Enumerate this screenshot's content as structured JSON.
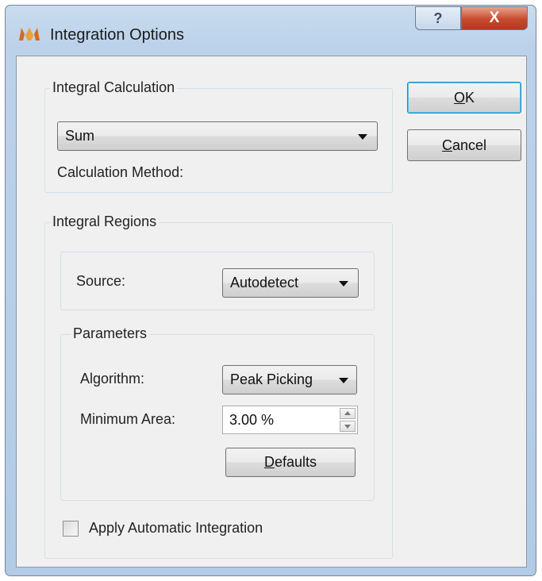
{
  "window": {
    "title": "Integration Options",
    "help_label": "?",
    "close_label": "X"
  },
  "buttons": {
    "ok_mnemonic": "O",
    "ok_rest": "K",
    "cancel_mnemonic": "C",
    "cancel_rest": "ancel",
    "defaults_mnemonic": "D",
    "defaults_rest": "efaults"
  },
  "integral_calculation": {
    "title": "Integral Calculation",
    "method_selected": "Sum",
    "method_label": "Calculation Method:"
  },
  "integral_regions": {
    "title": "Integral Regions",
    "source_label": "Source:",
    "source_selected": "Autodetect",
    "parameters": {
      "title": "Parameters",
      "algorithm_label": "Algorithm:",
      "algorithm_selected": "Peak Picking",
      "min_area_label": "Minimum Area:",
      "min_area_value": "3.00 %"
    },
    "auto_integration_label": "Apply Automatic Integration",
    "auto_integration_checked": false
  },
  "colors": {
    "titlebar": "#bcd2ea",
    "close_button": "#c84a2c",
    "client_bg": "#f0f0f0",
    "focus_border": "#3c7fb1"
  },
  "icons": {
    "app": "app-logo-icon",
    "help": "help-icon",
    "close": "close-icon"
  }
}
